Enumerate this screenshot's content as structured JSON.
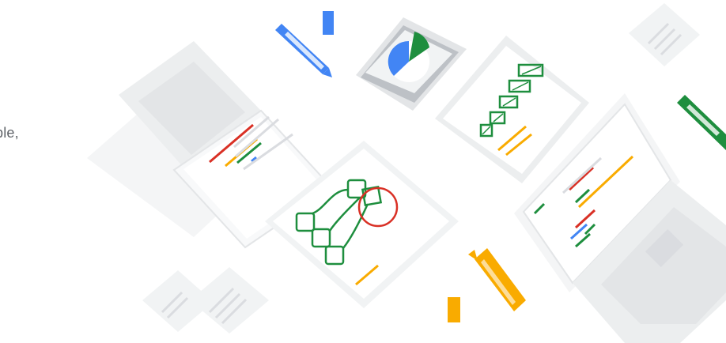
{
  "hero": {
    "clipped_text": "ple,",
    "colors": {
      "red": "#d93025",
      "yellow": "#f9ab00",
      "green": "#1e8e3e",
      "blue": "#4285f4",
      "gray_light": "#f1f3f4",
      "gray_mid": "#dadce0",
      "gray_dark": "#bdc1c6"
    },
    "icons": [
      "laptop-left-icon",
      "laptop-right-icon",
      "marker-blue-icon",
      "marker-green-icon",
      "marker-yellow-icon",
      "pie-chart-card-icon",
      "bar-chart-card-icon",
      "flowchart-card-icon",
      "keyboard-tile-icon"
    ],
    "pie_chart": {
      "slices": [
        {
          "color": "blue",
          "fraction": 0.33
        },
        {
          "color": "green",
          "fraction": 0.17
        },
        {
          "color": "white",
          "fraction": 0.5
        }
      ]
    }
  }
}
